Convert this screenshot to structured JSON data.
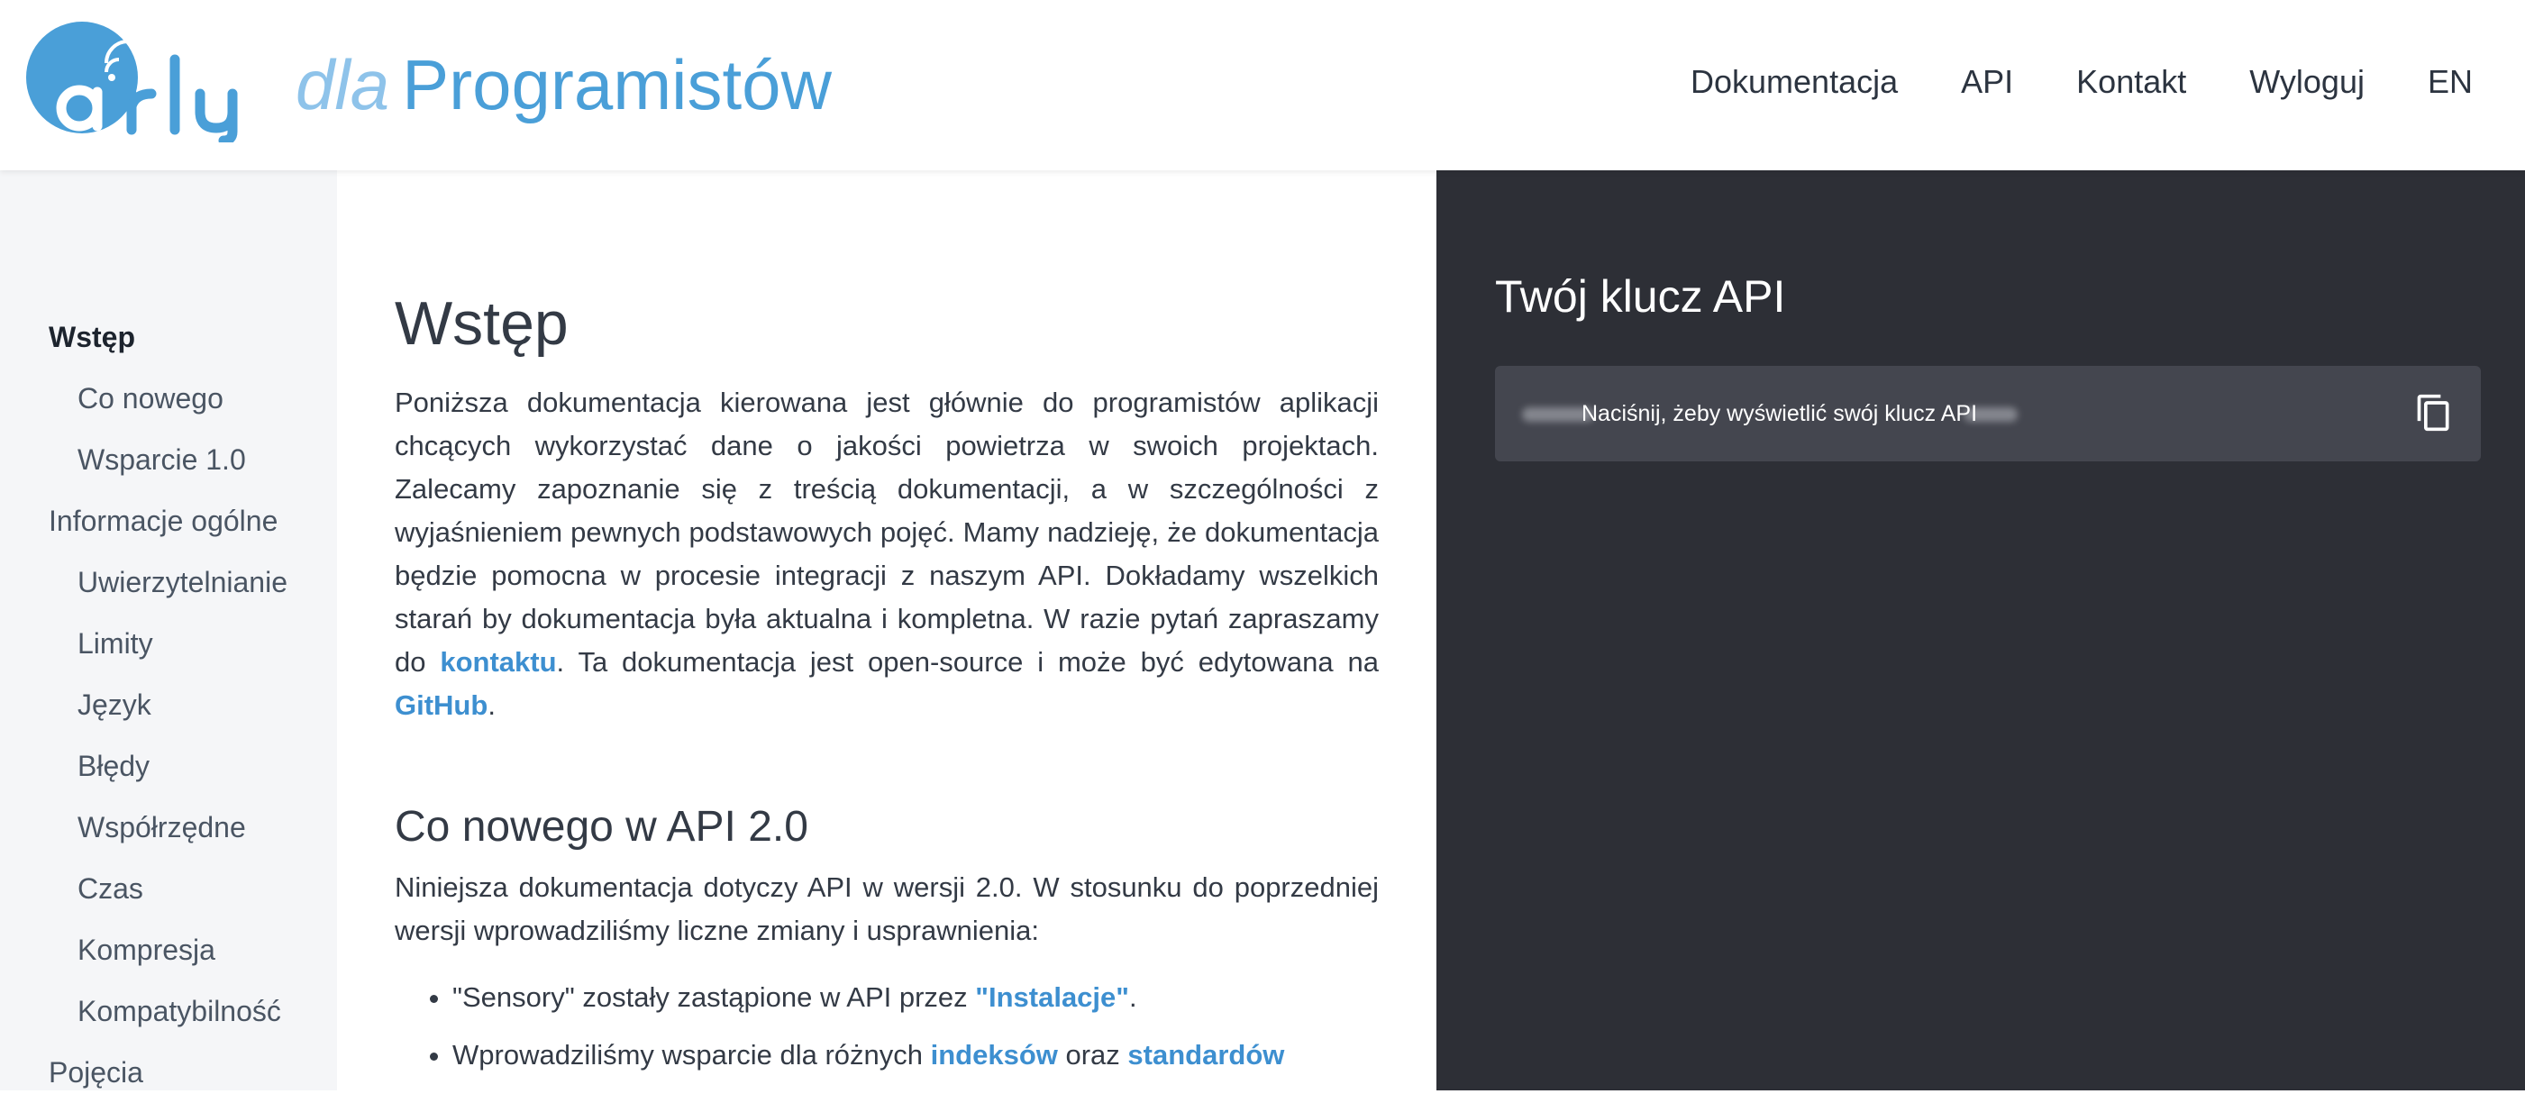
{
  "header": {
    "brand_prefix": "dla",
    "brand_name": "Programistów",
    "nav": [
      "Dokumentacja",
      "API",
      "Kontakt",
      "Wyloguj",
      "EN"
    ]
  },
  "sidebar": {
    "items": [
      {
        "label": "Wstęp",
        "level": 0,
        "active": true
      },
      {
        "label": "Co nowego",
        "level": 1
      },
      {
        "label": "Wsparcie 1.0",
        "level": 1
      },
      {
        "label": "Informacje ogólne",
        "level": 0
      },
      {
        "label": "Uwierzytelnianie",
        "level": 1
      },
      {
        "label": "Limity",
        "level": 1
      },
      {
        "label": "Język",
        "level": 1
      },
      {
        "label": "Błędy",
        "level": 1
      },
      {
        "label": "Współrzędne",
        "level": 1
      },
      {
        "label": "Czas",
        "level": 1
      },
      {
        "label": "Kompresja",
        "level": 1
      },
      {
        "label": "Kompatybilność",
        "level": 1
      },
      {
        "label": "Pojęcia",
        "level": 0
      }
    ]
  },
  "main": {
    "title": "Wstęp",
    "intro_text": "Poniższa dokumentacja kierowana jest głównie do programistów aplikacji chcących wykorzystać dane o jakości powietrza w swoich projektach. Zalecamy zapoznanie się z treścią dokumentacji, a w szczególności z wyjaśnieniem pewnych podstawowych pojęć. Mamy nadzieję, że dokumentacja będzie pomocna w procesie integracji z naszym API. Dokładamy wszelkich starań by dokumentacja była aktualna i kompletna. W razie pytań zapraszamy do",
    "contact_link": "kontaktu",
    "intro_mid": ". Ta dokumentacja jest open-source i może być edytowana na",
    "github_link": "GitHub",
    "intro_end": ".",
    "section2_title": "Co nowego w API 2.0",
    "section2_text": "Niniejsza dokumentacja dotyczy API w wersji 2.0. W stosunku do poprzedniej wersji wprowadziliśmy liczne zmiany i usprawnienia:",
    "bullets": [
      {
        "pre": "\"Sensory\" zostały zastąpione w API przez ",
        "link": "\"Instalacje\"",
        "post": "."
      },
      {
        "pre": "Wprowadziliśmy wsparcie dla różnych ",
        "link": "indeksów",
        "mid": " oraz ",
        "link2": "standardów"
      }
    ]
  },
  "panel": {
    "title": "Twój klucz API",
    "key_hint": "Naciśnij, żeby wyświetlić swój klucz API"
  },
  "colors": {
    "accent": "#3d8fd0",
    "panel_bg": "#2d2f36",
    "keybox_bg": "#44464f",
    "sidebar_bg": "#f5f6f8"
  },
  "icons": {
    "logo": "airly-logo",
    "copy": "copy-icon"
  }
}
